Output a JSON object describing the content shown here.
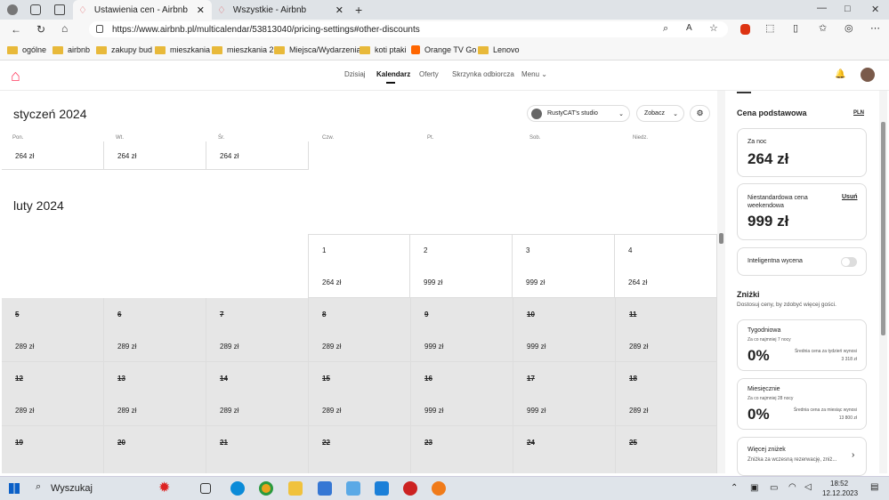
{
  "browser": {
    "tabs": [
      {
        "label": "Ustawienia cen - Airbnb"
      },
      {
        "label": "Wszystkie - Airbnb"
      }
    ],
    "url": "https://www.airbnb.pl/multicalendar/53813040/pricing-settings#other-discounts"
  },
  "bookmarks": [
    "ogólne",
    "airbnb",
    "zakupy bud",
    "mieszkania",
    "mieszkania 2",
    "Miejsca/Wydarzenia",
    "koti ptaki",
    "Orange TV Go",
    "Lenovo"
  ],
  "nav": {
    "items": [
      "Dzisiaj",
      "Kalendarz",
      "Oferty",
      "Skrzynka odbiorcza",
      "Menu"
    ]
  },
  "calendar": {
    "jan_title": "styczeń 2024",
    "feb_title": "luty 2024",
    "dow": [
      "Pon.",
      "Wt.",
      "Śr.",
      "Czw.",
      "Pt.",
      "Sob.",
      "Niedz."
    ],
    "listing": "RustyCAT's studio",
    "view": "Zobacz",
    "jan_prices": [
      "264 zł",
      "264 zł",
      "264 zł"
    ],
    "feb_row1": [
      {
        "d": "1",
        "p": "264 zł"
      },
      {
        "d": "2",
        "p": "999 zł"
      },
      {
        "d": "3",
        "p": "999 zł"
      },
      {
        "d": "4",
        "p": "264 zł"
      }
    ],
    "feb_row2": [
      {
        "d": "5",
        "p": "289 zł"
      },
      {
        "d": "6",
        "p": "289 zł"
      },
      {
        "d": "7",
        "p": "289 zł"
      },
      {
        "d": "8",
        "p": "289 zł"
      },
      {
        "d": "9",
        "p": "999 zł"
      },
      {
        "d": "10",
        "p": "999 zł"
      },
      {
        "d": "11",
        "p": "289 zł"
      }
    ],
    "feb_row3": [
      {
        "d": "12",
        "p": "289 zł"
      },
      {
        "d": "13",
        "p": "289 zł"
      },
      {
        "d": "14",
        "p": "289 zł"
      },
      {
        "d": "15",
        "p": "289 zł"
      },
      {
        "d": "16",
        "p": "999 zł"
      },
      {
        "d": "17",
        "p": "999 zł"
      },
      {
        "d": "18",
        "p": "289 zł"
      }
    ],
    "feb_row4": [
      {
        "d": "19"
      },
      {
        "d": "20"
      },
      {
        "d": "21"
      },
      {
        "d": "22"
      },
      {
        "d": "23"
      },
      {
        "d": "24"
      },
      {
        "d": "25"
      }
    ]
  },
  "panel": {
    "base_title": "Cena podstawowa",
    "currency": "PLN",
    "per_night_label": "Za noc",
    "per_night": "264 zł",
    "weekend_label": "Niestandardowa cena weekendowa",
    "weekend_remove": "Usuń",
    "weekend": "999 zł",
    "smart_label": "Inteligentna wycena",
    "discounts_title": "Zniżki",
    "discounts_sub": "Dostosuj ceny, by zdobyć więcej gości.",
    "weekly_title": "Tygodniowa",
    "weekly_sub": "Za co najmniej 7 nocy",
    "weekly_pct": "0%",
    "weekly_avg_label": "Średnia cena za tydzień wynosi",
    "weekly_avg": "3 318 zł",
    "monthly_title": "Miesięcznie",
    "monthly_sub": "Za co najmniej 28 nocy",
    "monthly_pct": "0%",
    "monthly_avg_label": "Średnia cena za miesiąc wynosi",
    "monthly_avg": "13 800 zł",
    "more_title": "Więcej zniżek",
    "more_sub": "Zniżka za wczesną rezerwację, zniż..."
  },
  "taskbar": {
    "search": "Wyszukaj",
    "time": "18:52",
    "date": "12.12.2023"
  }
}
